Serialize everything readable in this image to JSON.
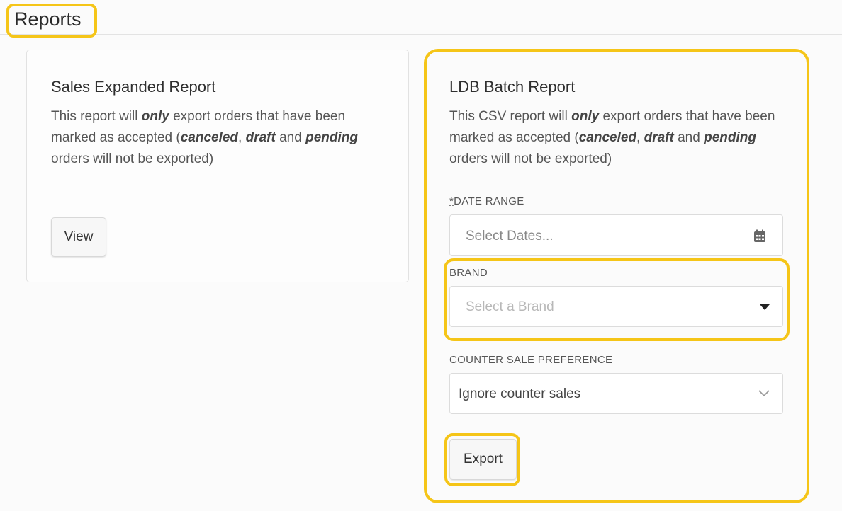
{
  "header": {
    "title": "Reports"
  },
  "sales_report": {
    "title": "Sales Expanded Report",
    "desc_parts": [
      "This report will ",
      "only",
      " export orders that have been marked as accepted (",
      "canceled",
      ", ",
      "draft",
      " and ",
      "pending",
      " orders will not be exported)"
    ],
    "view_label": "View"
  },
  "ldb_report": {
    "title": "LDB Batch Report",
    "desc_parts": [
      "This CSV report will ",
      "only",
      " export orders that have been marked as accepted (",
      "canceled",
      ", ",
      "draft",
      " and ",
      "pending",
      " orders will not be exported)"
    ],
    "date_range": {
      "required_mark": "*",
      "label": "DATE RANGE",
      "placeholder": "Select Dates..."
    },
    "brand": {
      "label": "BRAND",
      "placeholder": "Select a Brand"
    },
    "counter_sale": {
      "label": "COUNTER SALE PREFERENCE",
      "value": "Ignore counter sales"
    },
    "export_label": "Export"
  },
  "icons": {
    "calendar": "calendar-icon",
    "caret": "caret-down-icon",
    "chevron": "chevron-down-icon"
  },
  "colors": {
    "highlight": "#f5c518",
    "background": "#fbfbfb"
  }
}
